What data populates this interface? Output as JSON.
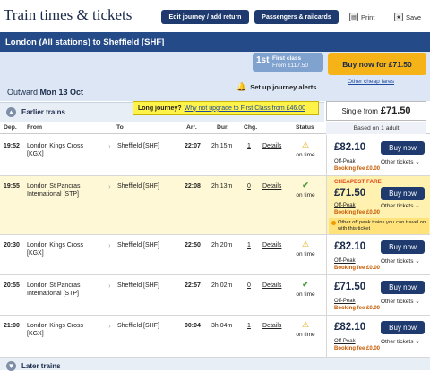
{
  "header": {
    "title": "Train times & tickets",
    "edit_journey": "Edit journey / add return",
    "passengers_railcards": "Passengers & railcards",
    "print": "Print",
    "save": "Save"
  },
  "route": "London (All stations) to Sheffield [SHF]",
  "first_class": {
    "number": "1st",
    "line1": "First class",
    "line2": "From £117.50"
  },
  "buy_now_main": "Buy now for £71.50",
  "other_cheap_fares": "Other cheap fares",
  "journey_alerts": "Set up journey alerts",
  "outward": {
    "label": "Outward",
    "date": "Mon 13 Oct"
  },
  "earlier_trains": "Earlier trains",
  "later_trains": "Later trains",
  "tooltip": {
    "lead": "Long journey?",
    "link": "Why not upgrade to First Class from £46.00"
  },
  "single_from": {
    "label": "Single from",
    "price": "£71.50"
  },
  "based_on": "Based on 1 adult",
  "columns": [
    "Dep.",
    "From",
    "To",
    "Arr.",
    "Dur.",
    "Chg.",
    "Status"
  ],
  "rows": [
    {
      "dep": "19:52",
      "from1": "London Kings Cross",
      "from2": "[KGX]",
      "to": "Sheffield [SHF]",
      "arr": "22:07",
      "dur": "2h 15m",
      "chg": "1",
      "details": "Details",
      "status": "on time",
      "price": "£82.10",
      "buy": "Buy now",
      "fare_type": "Off-Peak",
      "other": "Other tickets",
      "booking_fee": "Booking fee £0.00"
    },
    {
      "dep": "19:55",
      "from1": "London St Pancras",
      "from2": "International [STP]",
      "to": "Sheffield [SHF]",
      "arr": "22:08",
      "dur": "2h 13m",
      "chg": "0",
      "details": "Details",
      "status": "on time",
      "cheapest": "CHEAPEST FARE",
      "price": "£71.50",
      "buy": "Buy now",
      "fare_type": "Off-Peak",
      "other": "Other tickets",
      "booking_fee": "Booking fee £0.00",
      "note": "Other off peak trains you can travel on with this ticket"
    },
    {
      "dep": "20:30",
      "from1": "London Kings Cross",
      "from2": "[KGX]",
      "to": "Sheffield [SHF]",
      "arr": "22:50",
      "dur": "2h 20m",
      "chg": "1",
      "details": "Details",
      "status": "on time",
      "price": "£82.10",
      "buy": "Buy now",
      "fare_type": "Off-Peak",
      "other": "Other tickets",
      "booking_fee": "Booking fee £0.00"
    },
    {
      "dep": "20:55",
      "from1": "London St Pancras",
      "from2": "International [STP]",
      "to": "Sheffield [SHF]",
      "arr": "22:57",
      "dur": "2h 02m",
      "chg": "0",
      "details": "Details",
      "status": "on time",
      "price": "£71.50",
      "buy": "Buy now",
      "fare_type": "Off-Peak",
      "other": "Other tickets",
      "booking_fee": "Booking fee £0.00"
    },
    {
      "dep": "21:00",
      "from1": "London Kings Cross",
      "from2": "[KGX]",
      "to": "Sheffield [SHF]",
      "arr": "00:04",
      "dur": "3h 04m",
      "chg": "1",
      "details": "Details",
      "status": "on time",
      "price": "£82.10",
      "buy": "Buy now",
      "fare_type": "Off-Peak",
      "other": "Other tickets",
      "booking_fee": "Booking fee £0.00"
    }
  ]
}
